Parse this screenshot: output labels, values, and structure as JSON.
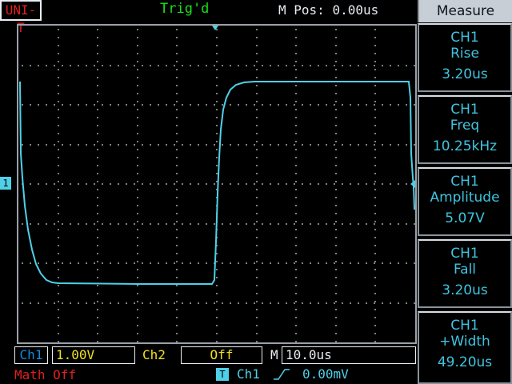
{
  "header": {
    "brand": "UNI-T",
    "trigger_status": "Trig'd",
    "m_pos_label": "M Pos:",
    "m_pos_value": "0.00us"
  },
  "channel_marker": "1",
  "side_panel": {
    "title": "Measure",
    "measurements": [
      {
        "channel": "CH1",
        "name": "Rise",
        "value": "3.20us"
      },
      {
        "channel": "CH1",
        "name": "Freq",
        "value": "10.25kHz"
      },
      {
        "channel": "CH1",
        "name": "Amplitude",
        "value": "5.07V"
      },
      {
        "channel": "CH1",
        "name": "Fall",
        "value": "3.20us"
      },
      {
        "channel": "CH1",
        "name": "+Width",
        "value": "49.20us"
      }
    ]
  },
  "status_bar": {
    "ch1_label": "Ch1",
    "ch1_scale": "1.00V",
    "ch2_label": "Ch2",
    "ch2_state": "Off",
    "timebase_label": "M",
    "timebase_value": "10.0us",
    "math_status": "Math Off",
    "trigger_badge": "T",
    "trigger_source": "Ch1",
    "trigger_edge_icon": "rising-edge-icon",
    "trigger_level": "0.00mV"
  },
  "colors": {
    "trace": "#4fd0e8",
    "trigger_text": "#18e018",
    "brand": "#e02020",
    "scale_text": "#f0e020"
  }
}
